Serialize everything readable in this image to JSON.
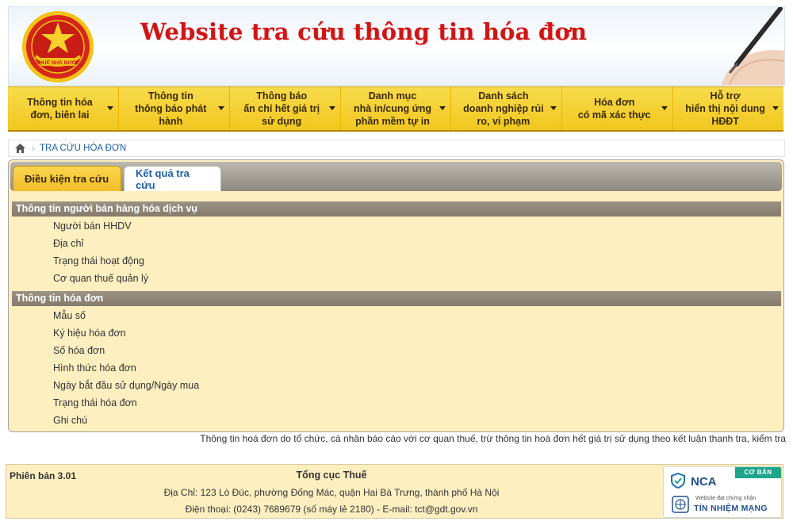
{
  "header": {
    "title": "Website tra cứu thông tin hóa đơn",
    "emblem_text": "THUẾ NHÀ NƯỚC"
  },
  "nav": {
    "items": [
      {
        "label": "Thông tin hóa\nđơn, biên lai"
      },
      {
        "label": "Thông tin\nthông báo phát\nhành"
      },
      {
        "label": "Thông báo\nấn chỉ hết giá trị\nsử dụng"
      },
      {
        "label": "Danh mục\nnhà in/cung ứng\nphần mềm tự in"
      },
      {
        "label": "Danh sách\ndoanh nghiệp rủi\nro, vi phạm"
      },
      {
        "label": "Hóa đơn\ncó mã xác thực"
      },
      {
        "label": "Hỗ trợ\nhiển thị nội dung\nHĐĐT"
      }
    ]
  },
  "breadcrumb": {
    "current": "TRA CỨU HÓA ĐƠN"
  },
  "tabs": {
    "conditions": "Điều kiện tra cứu",
    "results": "Kết quả tra cứu"
  },
  "seller_section": {
    "title": "Thông tin người bán hàng hóa dịch vụ",
    "fields": [
      "Người bán HHDV",
      "Địa chỉ",
      "Trạng thái hoạt động",
      "Cơ quan thuế quản lý"
    ]
  },
  "invoice_section": {
    "title": "Thông tin hóa đơn",
    "fields": [
      "Mẫu số",
      "Ký hiệu hóa đơn",
      "Số hóa đơn",
      "Hình thức hóa đơn",
      "Ngày bắt đầu sử dụng/Ngày mua",
      "Trạng thái hóa đơn",
      "Ghi chú"
    ]
  },
  "notice": "Thông tin hoá đơn do tổ chức, cá nhân báo cáo với cơ quan thuế, trừ thông tin hoá đơn hết giá trị sử dụng theo kết luận thanh tra, kiểm tra",
  "footer": {
    "version": "Phiên bản 3.01",
    "org": "Tổng cục Thuế",
    "address": "Địa Chỉ: 123 Lò Đúc, phường Đống Mác, quận Hai Bà Trưng, thành phố Hà Nội",
    "contact": "Điện thoại: (0243) 7689679 (số máy lẻ 2180) - E-mail: tct@gdt.gov.vn"
  },
  "nca_badge": {
    "level": "CƠ BẢN",
    "logo": "NCA",
    "subtitle": "Website đạt chứng nhận",
    "title": "TÍN NHIỆM MẠNG"
  },
  "colors": {
    "nav_bg": "#f1c81f",
    "panel_bg": "#fdefc0",
    "section_header_bg": "#857b6d",
    "title_red": "#d01515",
    "link_blue": "#1f5fa8"
  }
}
